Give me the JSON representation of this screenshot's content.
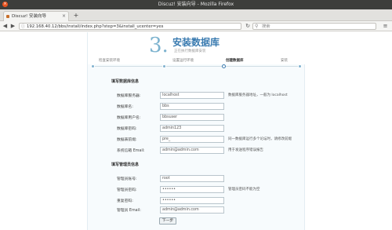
{
  "window": {
    "title": "Discuz! 安装向导 - Mozilla Firefox"
  },
  "tab": {
    "label": "Discuz! 安装向导"
  },
  "nav": {
    "url": "192.168.40.12/bbs/install/index.php?step=3&install_ucenter=yes",
    "search_placeholder": "搜索"
  },
  "header": {
    "step_number": "3.",
    "title": "安装数据库",
    "subtitle": "正在执行数据库安装"
  },
  "progress": {
    "steps": [
      "检查安装环境",
      "设置运行环境",
      "创建数据库",
      "安装"
    ],
    "active_index": 2
  },
  "db_section": {
    "title": "填写数据库信息",
    "fields": [
      {
        "label": "数据库服务器:",
        "value": "localhost",
        "hint": "数据库服务器地址，一般为 localhost"
      },
      {
        "label": "数据库名:",
        "value": "bbs",
        "hint": ""
      },
      {
        "label": "数据库用户名:",
        "value": "bbsuser",
        "hint": ""
      },
      {
        "label": "数据库密码:",
        "value": "admin123",
        "hint": ""
      },
      {
        "label": "数据表前缀:",
        "value": "pre_",
        "hint": "同一数据库运行多个论坛时，请修改前缀"
      },
      {
        "label": "系统信箱 Email:",
        "value": "admin@admin.com",
        "hint": "用于发送程序错误报告"
      }
    ]
  },
  "admin_section": {
    "title": "填写管理员信息",
    "fields": [
      {
        "label": "管理员账号:",
        "value": "root",
        "hint": ""
      },
      {
        "label": "管理员密码:",
        "value": "••••••",
        "hint": "管理员密码不能为空"
      },
      {
        "label": "重复密码:",
        "value": "••••••",
        "hint": ""
      },
      {
        "label": "管理员 Email:",
        "value": "admin@admin.com",
        "hint": ""
      }
    ]
  },
  "next_button": {
    "label": "下一步"
  }
}
